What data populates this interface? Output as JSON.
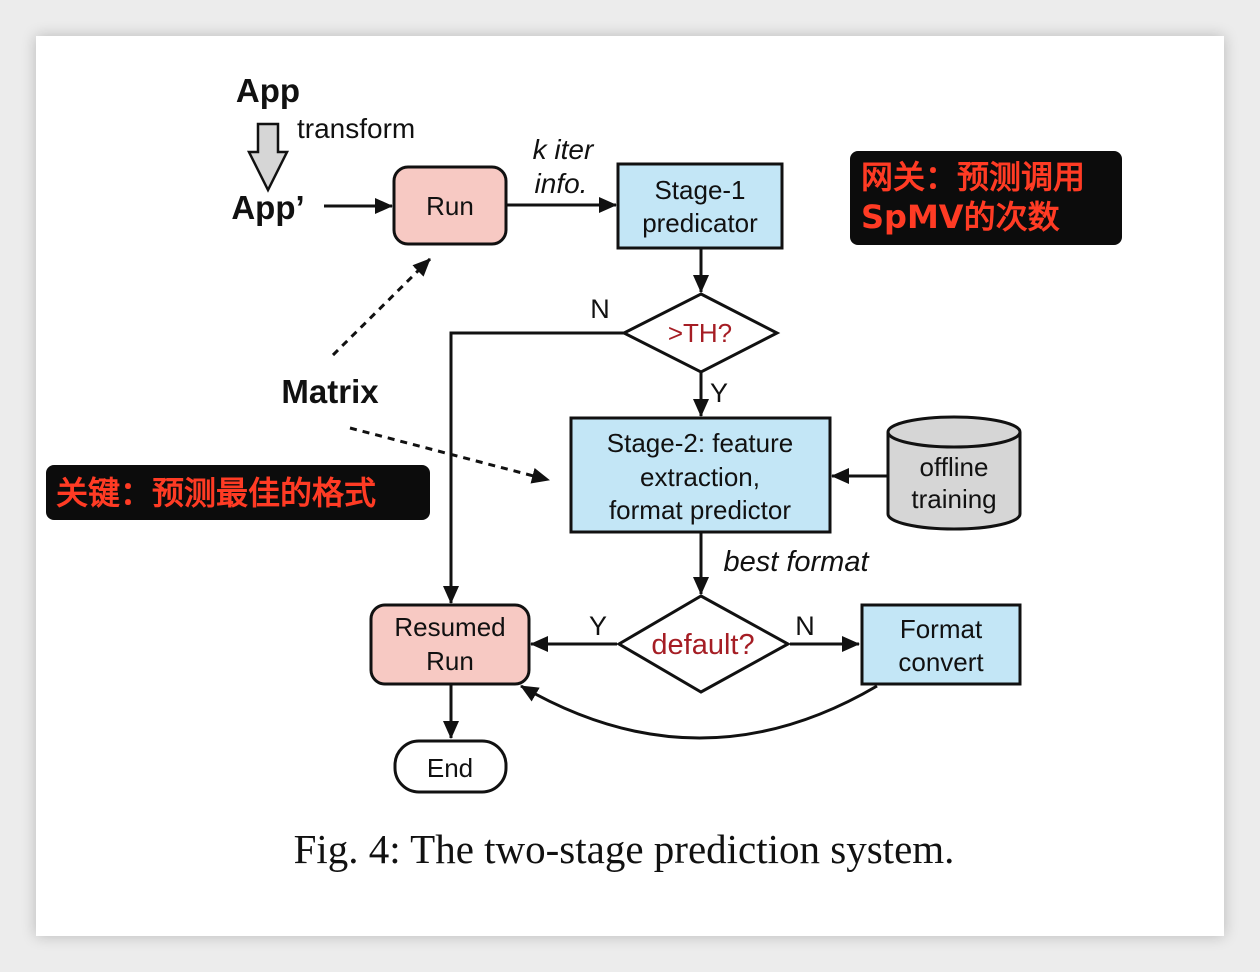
{
  "diagram": {
    "app_label": "App",
    "transform_label": "transform",
    "app_prime_label": "App’",
    "run_label": "Run",
    "k_iter_label": "k iter",
    "info_label": "info.",
    "stage1_line1": "Stage-1",
    "stage1_line2": "predicator",
    "decision1_label": ">TH?",
    "decision1_no": "N",
    "decision1_yes": "Y",
    "matrix_label": "Matrix",
    "stage2_line1": "Stage-2: feature",
    "stage2_line2": "extraction,",
    "stage2_line3": "format predictor",
    "offline_line1": "offline",
    "offline_line2": "training",
    "best_format_label": "best format",
    "decision2_label": "default?",
    "decision2_yes": "Y",
    "decision2_no": "N",
    "resumed_line1": "Resumed",
    "resumed_line2": "Run",
    "format_line1": "Format",
    "format_line2": "convert",
    "end_label": "End"
  },
  "annotations": {
    "gateway_line1": "网关：预测调用",
    "gateway_line2": "SpMV的次数",
    "key_label": "关键：预测最佳的格式"
  },
  "caption": "Fig. 4: The two-stage prediction system.",
  "colors": {
    "pink_fill": "#f7c9c3",
    "blue_fill": "#c3e6f6",
    "decision_text": "#a51d24",
    "annotation_bg": "#0c0c0c",
    "annotation_text": "#ff3b24",
    "cylinder_fill": "#d6d6d6"
  }
}
